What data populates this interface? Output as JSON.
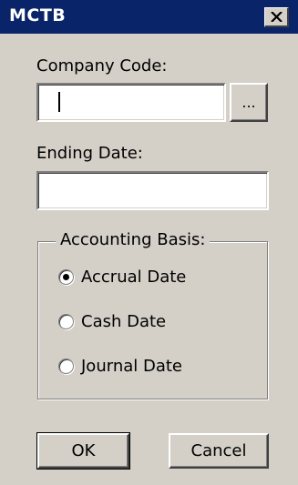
{
  "window": {
    "title": "MCTB"
  },
  "company_code": {
    "label": "Company Code:",
    "value": "",
    "browse_label": "..."
  },
  "ending_date": {
    "label": "Ending Date:",
    "value": ""
  },
  "accounting_basis": {
    "label": "Accounting Basis:",
    "options": [
      {
        "label": "Accrual Date",
        "checked": true
      },
      {
        "label": "Cash Date",
        "checked": false
      },
      {
        "label": "Journal Date",
        "checked": false
      }
    ]
  },
  "buttons": {
    "ok": "OK",
    "cancel": "Cancel"
  },
  "icons": {
    "close": "close-icon"
  }
}
